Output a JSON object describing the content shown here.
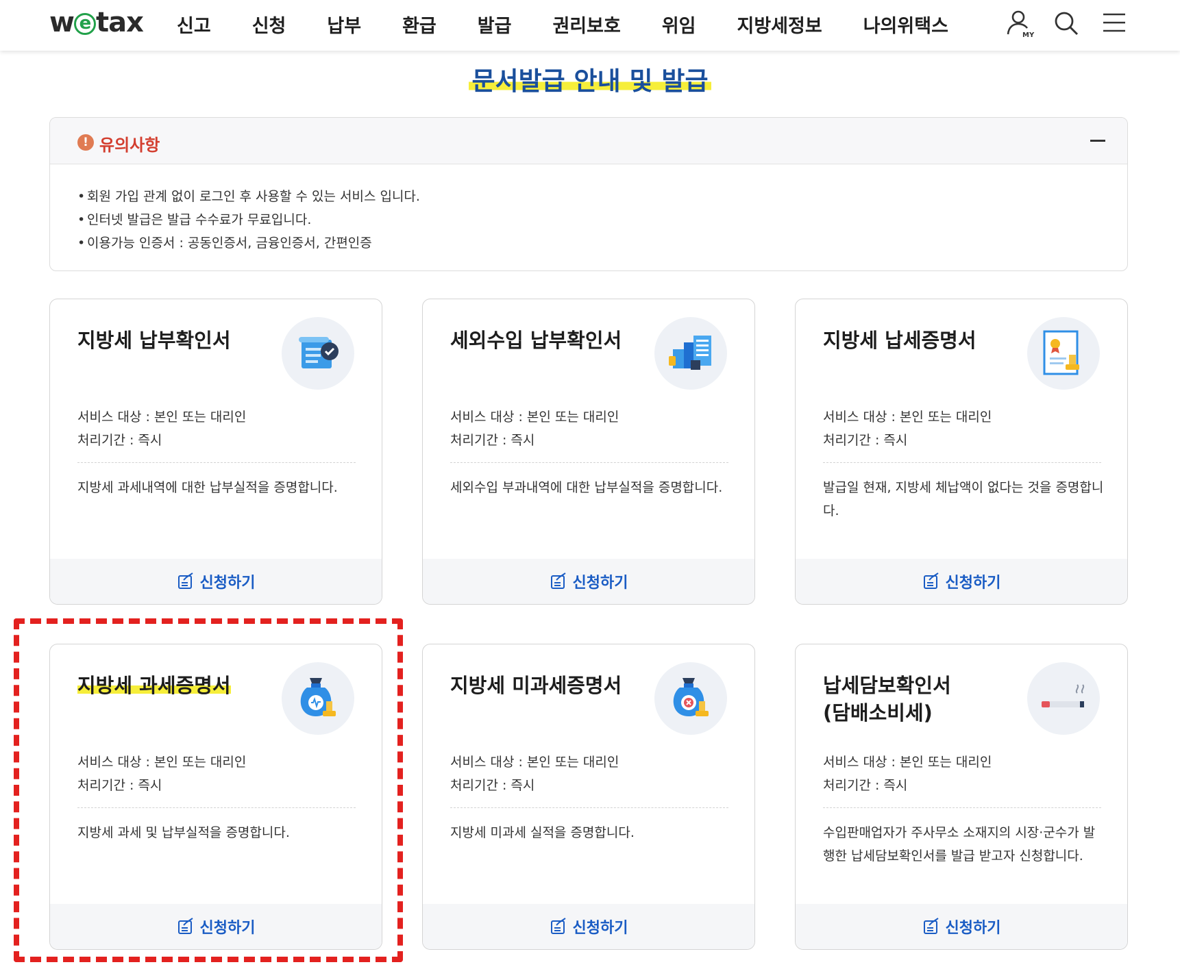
{
  "header": {
    "logo": {
      "pre": "w",
      "mid": "e",
      "post": "tax"
    },
    "nav": [
      "신고",
      "신청",
      "납부",
      "환급",
      "발급",
      "권리보호",
      "위임",
      "지방세정보",
      "나의위택스"
    ],
    "icons": [
      "my-user-icon",
      "search-icon",
      "menu-icon"
    ]
  },
  "page": {
    "title": "문서발급 안내 및 발급"
  },
  "notice": {
    "title": "유의사항",
    "items": [
      "회원 가입 관계 없이 로그인 후 사용할 수 있는 서비스 입니다.",
      "인터넷 발급은 발급 수수료가 무료입니다.",
      "이용가능 인증서 : 공동인증서, 금융인증서, 간편인증"
    ]
  },
  "cards": [
    {
      "title": "지방세 납부확인서",
      "target": "서비스 대상 : 본인 또는 대리인",
      "period": "처리기간 : 즉시",
      "desc": "지방세 과세내역에 대한 납부실적을 증명합니다.",
      "button": "신청하기",
      "icon": "document-check-icon"
    },
    {
      "title": "세외수입 납부확인서",
      "target": "서비스 대상 : 본인 또는 대리인",
      "period": "처리기간 : 즉시",
      "desc": "세외수입 부과내역에 대한 납부실적을 증명합니다.",
      "button": "신청하기",
      "icon": "building-documents-icon"
    },
    {
      "title": "지방세 납세증명서",
      "target": "서비스 대상 : 본인 또는 대리인",
      "period": "처리기간 : 즉시",
      "desc": "발급일 현재, 지방세 체납액이 없다는 것을 증명합니다.",
      "button": "신청하기",
      "icon": "certificate-stamp-icon"
    },
    {
      "title": "지방세 과세증명서",
      "target": "서비스 대상 : 본인 또는 대리인",
      "period": "처리기간 : 즉시",
      "desc": "지방세 과세 및 납부실적을 증명합니다.",
      "button": "신청하기",
      "icon": "tax-bag-stamp-icon"
    },
    {
      "title": "지방세 미과세증명서",
      "target": "서비스 대상 : 본인 또는 대리인",
      "period": "처리기간 : 즉시",
      "desc": "지방세 미과세 실적을 증명합니다.",
      "button": "신청하기",
      "icon": "tax-bag-x-icon"
    },
    {
      "title": "납세담보확인서\n(담배소비세)",
      "target": "서비스 대상 : 본인 또는 대리인",
      "period": "처리기간 : 즉시",
      "desc": "수입판매업자가 주사무소 소재지의 시장·군수가 발행한 납세담보확인서를 발급 받고자 신청합니다.",
      "button": "신청하기",
      "icon": "cigarette-icon"
    }
  ],
  "colors": {
    "brand_green": "#22a14a",
    "title_blue": "#1a4f9c",
    "button_blue": "#1a5cc4",
    "notice_red": "#d33e2f",
    "highlight_yellow": "#f6ee3a",
    "annotation_red": "#e3211f"
  }
}
